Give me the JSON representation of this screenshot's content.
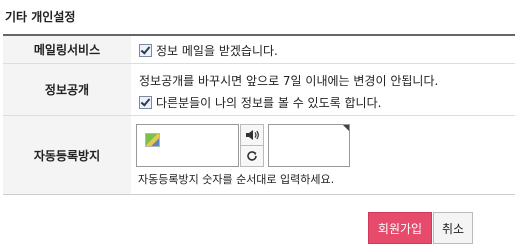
{
  "section": {
    "title": "기타 개인설정"
  },
  "rows": {
    "mailing": {
      "label": "메일링서비스",
      "checkbox_label": "정보 메일을 받겠습니다."
    },
    "public": {
      "label": "정보공개",
      "notice": "정보공개를 바꾸시면 앞으로 7일 이내에는 변경이 안됩니다.",
      "checkbox_label": "다른분들이 나의 정보를 볼 수 있도록 합니다."
    },
    "captcha": {
      "label": "자동등록방지",
      "help": "자동등록방지 숫자를 순서대로 입력하세요."
    }
  },
  "buttons": {
    "signup": "회원가입",
    "cancel": "취소"
  },
  "colors": {
    "accent": "#e64b6c",
    "header_bg": "#f4f4f4"
  }
}
